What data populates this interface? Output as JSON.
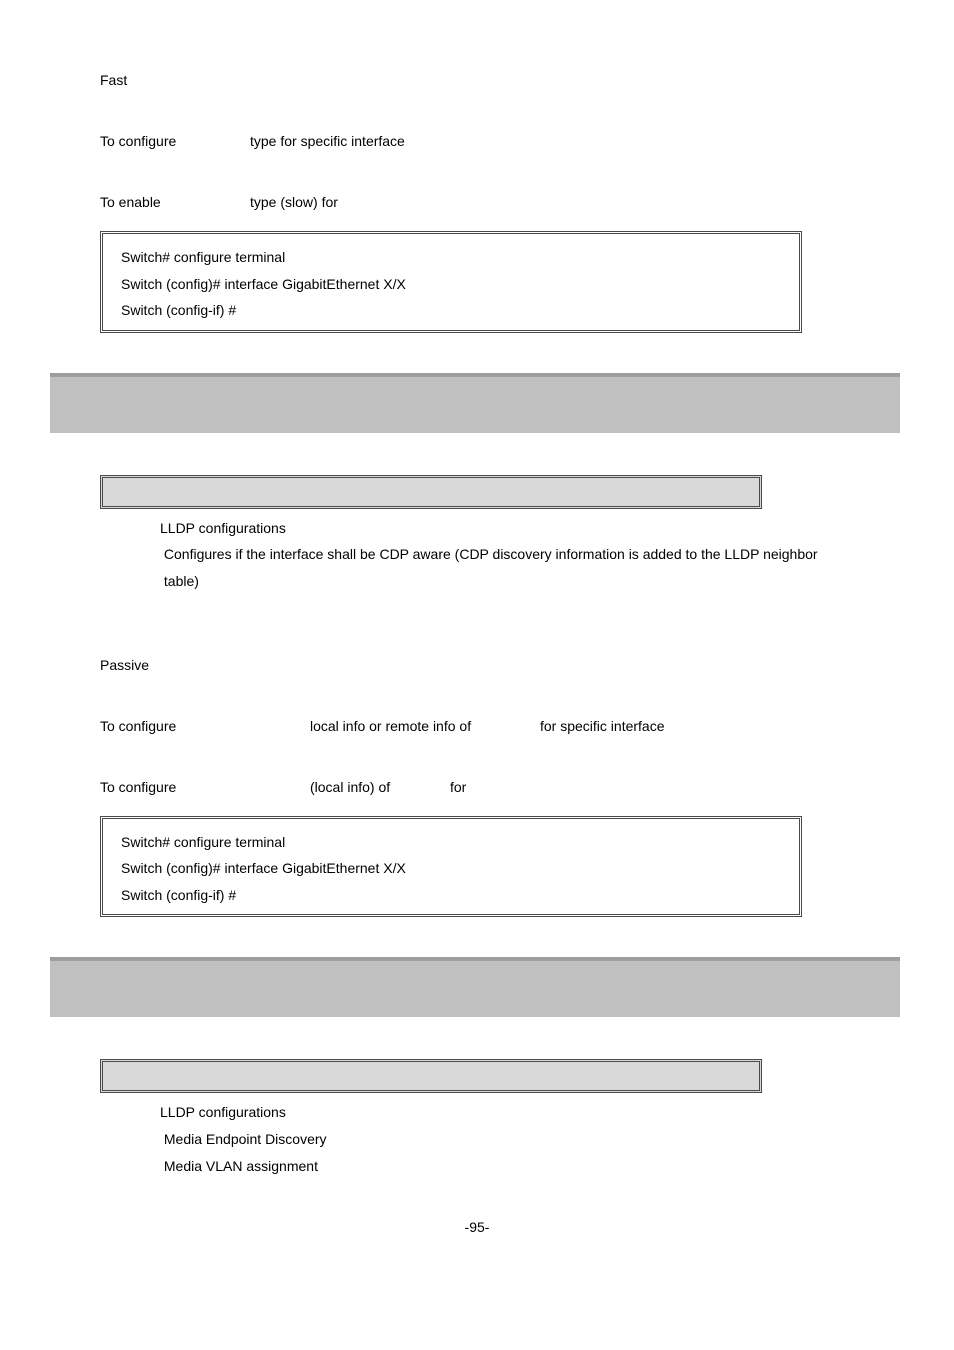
{
  "top": {
    "fast": "Fast",
    "conf_line": {
      "lead": "To configure",
      "rest": "type for specific interface"
    },
    "enable_line": {
      "lead": "To enable",
      "rest": "type (slow) for"
    },
    "code": {
      "l1": "Switch# configure terminal",
      "l2": "Switch (config)# interface GigabitEthernet X/X",
      "l3": "Switch (config-if) #"
    }
  },
  "mid": {
    "sub1": "LLDP   configurations",
    "sub2": " Configures if the interface shall be CDP aware (CDP discovery information is added to the LLDP neighbor",
    "sub3": " table)",
    "passive": "Passive",
    "conf_line1": {
      "lead": "To configure",
      "mid": "local info or remote info of",
      "tail": "for specific interface"
    },
    "conf_line2": {
      "lead": "To configure",
      "mid": "(local info) of",
      "tail": "for"
    },
    "code": {
      "l1": "Switch# configure terminal",
      "l2": "Switch (config)# interface GigabitEthernet X/X",
      "l3": "Switch (config-if) #"
    }
  },
  "bot": {
    "sub1": "LLDP   configurations",
    "sub2": " Media Endpoint Discovery",
    "sub3": " Media VLAN assignment"
  },
  "page_num": "-95-"
}
